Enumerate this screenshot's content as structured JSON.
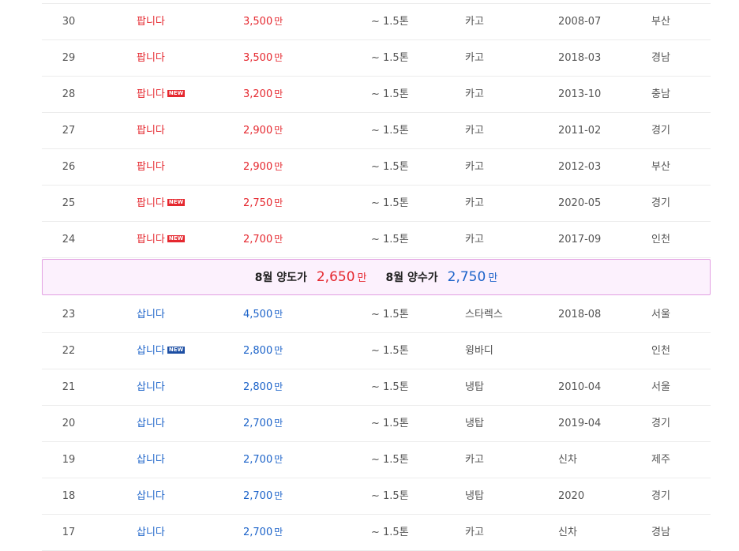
{
  "listing": {
    "price_unit": "만",
    "new_badge": "NEW",
    "sell_rows": [
      {
        "no": "30",
        "type": "팝니다",
        "price": "3,500",
        "tonnage": "~ 1.5톤",
        "body": "카고",
        "year": "2008-07",
        "region": "부산",
        "is_new": false
      },
      {
        "no": "29",
        "type": "팝니다",
        "price": "3,500",
        "tonnage": "~ 1.5톤",
        "body": "카고",
        "year": "2018-03",
        "region": "경남",
        "is_new": false
      },
      {
        "no": "28",
        "type": "팝니다",
        "price": "3,200",
        "tonnage": "~ 1.5톤",
        "body": "카고",
        "year": "2013-10",
        "region": "충남",
        "is_new": true
      },
      {
        "no": "27",
        "type": "팝니다",
        "price": "2,900",
        "tonnage": "~ 1.5톤",
        "body": "카고",
        "year": "2011-02",
        "region": "경기",
        "is_new": false
      },
      {
        "no": "26",
        "type": "팝니다",
        "price": "2,900",
        "tonnage": "~ 1.5톤",
        "body": "카고",
        "year": "2012-03",
        "region": "부산",
        "is_new": false
      },
      {
        "no": "25",
        "type": "팝니다",
        "price": "2,750",
        "tonnage": "~ 1.5톤",
        "body": "카고",
        "year": "2020-05",
        "region": "경기",
        "is_new": true
      },
      {
        "no": "24",
        "type": "팝니다",
        "price": "2,700",
        "tonnage": "~ 1.5톤",
        "body": "카고",
        "year": "2017-09",
        "region": "인천",
        "is_new": true
      }
    ],
    "summary": {
      "transfer_label": "8월 양도가",
      "transfer_value": "2,650",
      "acquire_label": "8월 양수가",
      "acquire_value": "2,750",
      "unit": "만"
    },
    "buy_rows": [
      {
        "no": "23",
        "type": "삽니다",
        "price": "4,500",
        "tonnage": "~ 1.5톤",
        "body": "스타렉스",
        "year": "2018-08",
        "region": "서울",
        "is_new": false
      },
      {
        "no": "22",
        "type": "삽니다",
        "price": "2,800",
        "tonnage": "~ 1.5톤",
        "body": "윙바디",
        "year": "",
        "region": "인천",
        "is_new": true
      },
      {
        "no": "21",
        "type": "삽니다",
        "price": "2,800",
        "tonnage": "~ 1.5톤",
        "body": "냉탑",
        "year": "2010-04",
        "region": "서울",
        "is_new": false
      },
      {
        "no": "20",
        "type": "삽니다",
        "price": "2,700",
        "tonnage": "~ 1.5톤",
        "body": "냉탑",
        "year": "2019-04",
        "region": "경기",
        "is_new": false
      },
      {
        "no": "19",
        "type": "삽니다",
        "price": "2,700",
        "tonnage": "~ 1.5톤",
        "body": "카고",
        "year": "신차",
        "region": "제주",
        "is_new": false
      },
      {
        "no": "18",
        "type": "삽니다",
        "price": "2,700",
        "tonnage": "~ 1.5톤",
        "body": "냉탑",
        "year": "2020",
        "region": "경기",
        "is_new": false
      },
      {
        "no": "17",
        "type": "삽니다",
        "price": "2,700",
        "tonnage": "~ 1.5톤",
        "body": "카고",
        "year": "신차",
        "region": "경남",
        "is_new": false
      }
    ]
  }
}
